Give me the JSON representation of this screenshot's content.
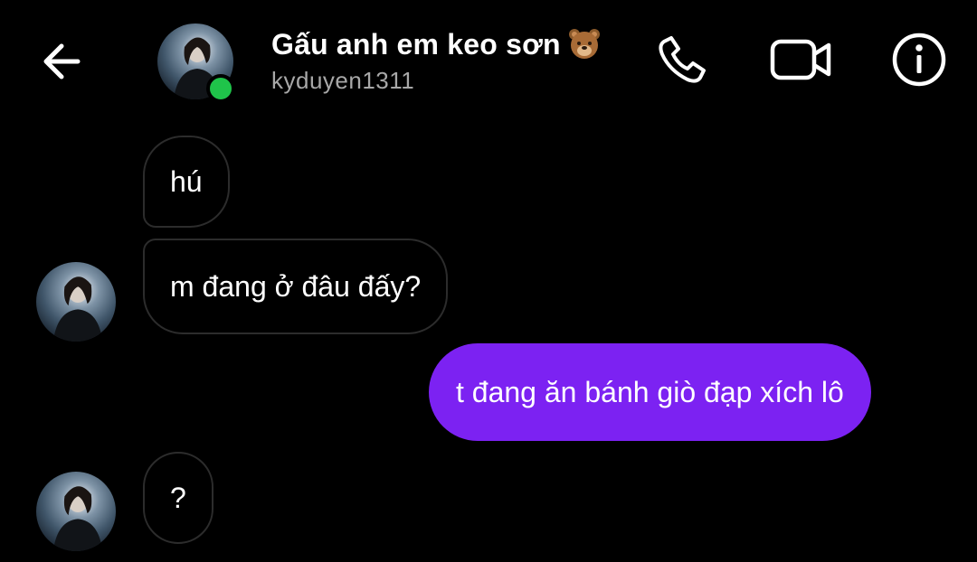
{
  "header": {
    "back_icon": "arrow-left-icon",
    "title": "Gấu anh em keo sơn",
    "title_emoji": "bear-face-emoji",
    "username": "kyduyen1311",
    "online": true,
    "actions": [
      {
        "icon": "phone-icon"
      },
      {
        "icon": "video-camera-icon"
      },
      {
        "icon": "info-icon"
      }
    ]
  },
  "messages": [
    {
      "direction": "incoming",
      "text": "hú"
    },
    {
      "direction": "incoming",
      "text": "m đang ở đâu đấy?"
    },
    {
      "direction": "outgoing",
      "text": "t đang ăn bánh giò đạp xích lô"
    },
    {
      "direction": "incoming",
      "text": "?"
    }
  ],
  "colors": {
    "background": "#000000",
    "outgoing_bubble": "#7c22f2",
    "incoming_border": "#2c2c2c",
    "online_dot": "#1fc44a",
    "username": "#a8a8a8"
  }
}
